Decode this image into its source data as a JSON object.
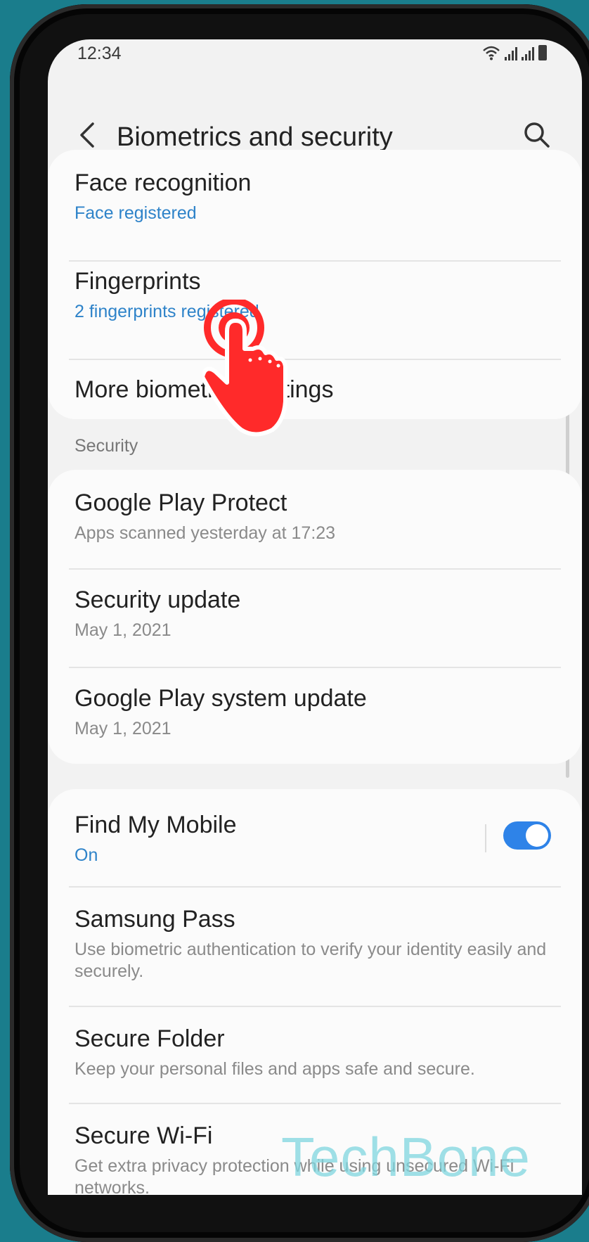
{
  "status": {
    "time": "12:34"
  },
  "appbar": {
    "title": "Biometrics and security"
  },
  "biometrics": [
    {
      "title": "Face recognition",
      "subtitle": "Face registered"
    },
    {
      "title": "Fingerprints",
      "subtitle": "2 fingerprints registered"
    },
    {
      "title": "More biometrics settings"
    }
  ],
  "security_section": {
    "label": "Security"
  },
  "security": [
    {
      "title": "Google Play Protect",
      "subtitle": "Apps scanned yesterday at 17:23"
    },
    {
      "title": "Security update",
      "subtitle": "May 1, 2021"
    },
    {
      "title": "Google Play system update",
      "subtitle": "May 1, 2021"
    }
  ],
  "misc": [
    {
      "title": "Find My Mobile",
      "subtitle": "On",
      "toggle_on": true
    },
    {
      "title": "Samsung Pass",
      "subtitle": "Use biometric authentication to verify your identity easily and securely."
    },
    {
      "title": "Secure Folder",
      "subtitle": "Keep your personal files and apps safe and secure."
    },
    {
      "title": "Secure Wi-Fi",
      "subtitle": "Get extra privacy protection while using unsecured Wi-Fi networks."
    }
  ],
  "watermark": "TechBone",
  "colors": {
    "accent": "#2e83c9",
    "toggle": "#2e83e8",
    "background": "#1a7d8c",
    "tap_indicator": "#ff2a2a"
  }
}
